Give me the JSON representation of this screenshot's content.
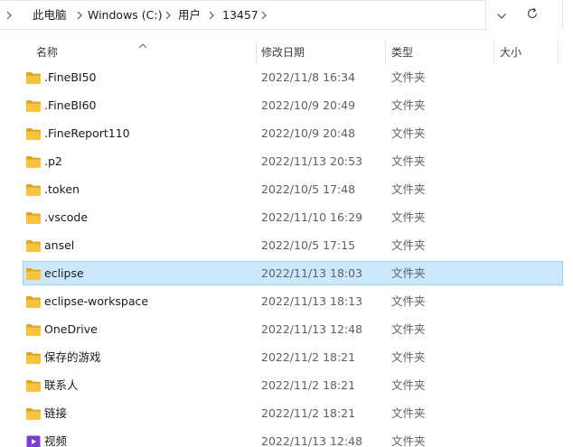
{
  "address_bar": {
    "breadcrumbs": [
      {
        "label": "此电脑"
      },
      {
        "label": "Windows (C:)"
      },
      {
        "label": "用户"
      },
      {
        "label": "13457"
      }
    ]
  },
  "columns": {
    "name": "名称",
    "date_modified": "修改日期",
    "type": "类型",
    "size": "大小",
    "sorted_by": "name"
  },
  "colors": {
    "folder": "#f8c33c",
    "folder_dark": "#e3a21a",
    "selection_bg": "#cce8ff",
    "selection_border": "#99d1ff",
    "video_icon": "#7b3fd3"
  },
  "files": [
    {
      "name": ".FineBI50",
      "date": "2022/11/8 16:34",
      "type": "文件夹",
      "icon": "folder-icon",
      "selected": false
    },
    {
      "name": ".FineBI60",
      "date": "2022/10/9 20:49",
      "type": "文件夹",
      "icon": "folder-icon",
      "selected": false
    },
    {
      "name": ".FineReport110",
      "date": "2022/10/9 20:48",
      "type": "文件夹",
      "icon": "folder-icon",
      "selected": false
    },
    {
      "name": ".p2",
      "date": "2022/11/13 20:53",
      "type": "文件夹",
      "icon": "folder-icon",
      "selected": false
    },
    {
      "name": ".token",
      "date": "2022/10/5 17:48",
      "type": "文件夹",
      "icon": "folder-icon",
      "selected": false
    },
    {
      "name": ".vscode",
      "date": "2022/11/10 16:29",
      "type": "文件夹",
      "icon": "folder-icon",
      "selected": false
    },
    {
      "name": "ansel",
      "date": "2022/10/5 17:15",
      "type": "文件夹",
      "icon": "folder-icon",
      "selected": false
    },
    {
      "name": "eclipse",
      "date": "2022/11/13 18:03",
      "type": "文件夹",
      "icon": "folder-icon",
      "selected": true
    },
    {
      "name": "eclipse-workspace",
      "date": "2022/11/13 18:13",
      "type": "文件夹",
      "icon": "folder-icon",
      "selected": false
    },
    {
      "name": "OneDrive",
      "date": "2022/11/13 12:48",
      "type": "文件夹",
      "icon": "folder-icon",
      "selected": false
    },
    {
      "name": "保存的游戏",
      "date": "2022/11/2 18:21",
      "type": "文件夹",
      "icon": "folder-icon",
      "selected": false
    },
    {
      "name": "联系人",
      "date": "2022/11/2 18:21",
      "type": "文件夹",
      "icon": "folder-icon",
      "selected": false
    },
    {
      "name": "链接",
      "date": "2022/11/2 18:21",
      "type": "文件夹",
      "icon": "folder-icon",
      "selected": false
    },
    {
      "name": "视频",
      "date": "2022/11/13 12:48",
      "type": "文件夹",
      "icon": "video-folder-icon",
      "selected": false
    }
  ]
}
